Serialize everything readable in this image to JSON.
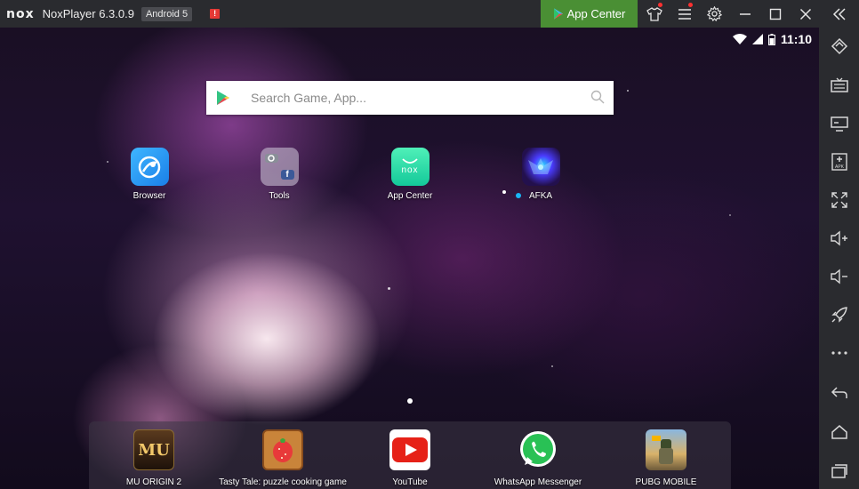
{
  "titlebar": {
    "logo": "nox",
    "title": "NoxPlayer 6.3.0.9",
    "android": "Android 5",
    "warning": "!",
    "app_center": "App Center"
  },
  "status_bar": {
    "time": "11:10"
  },
  "search": {
    "placeholder": "Search Game, App..."
  },
  "desktop_apps": [
    {
      "label": "Browser"
    },
    {
      "label": "Tools"
    },
    {
      "label": "App Center",
      "icon_text": "nox"
    },
    {
      "label": "AFKA"
    }
  ],
  "dock_apps": [
    {
      "label": "MU ORIGIN 2",
      "icon_text": "MU"
    },
    {
      "label": "Tasty Tale: puzzle cooking game"
    },
    {
      "label": "YouTube"
    },
    {
      "label": "WhatsApp Messenger"
    },
    {
      "label": "PUBG MOBILE"
    }
  ],
  "sidebar": {
    "buttons": [
      "multi-instance-icon",
      "keyboard-icon",
      "screen-icon",
      "apk-install-icon",
      "fullscreen-icon",
      "volume-up-icon",
      "volume-down-icon",
      "rocket-icon",
      "more-icon",
      "back-icon",
      "home-icon",
      "recent-apps-icon"
    ],
    "apk_text": "APK"
  },
  "colors": {
    "app_center_green": "#4a8f34",
    "chrome": "#2a2b2f"
  }
}
